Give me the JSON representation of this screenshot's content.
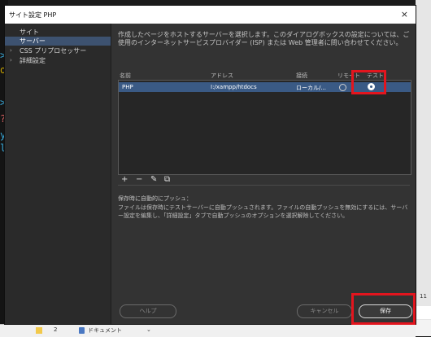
{
  "dialog": {
    "title": "サイト設定 PHP",
    "close_glyph": "×"
  },
  "sidebar": {
    "items": [
      {
        "label": "サイト",
        "chevron": ""
      },
      {
        "label": "サーバー",
        "chevron": ""
      },
      {
        "label": "CSS プリプロセッサー",
        "chevron": "›"
      },
      {
        "label": "詳細設定",
        "chevron": "›"
      }
    ],
    "selected_index": 1
  },
  "content": {
    "description": "作成したページをホストするサーバーを選択します。このダイアログボックスの設定については、ご使用のインターネットサービスプロバイダー (ISP) または Web 管理者に問い合わせてください。",
    "columns": [
      "名前",
      "アドレス",
      "接続",
      "リモート",
      "テスト"
    ],
    "rows": [
      {
        "name": "PHP",
        "address": "I:/xampp/htdocs",
        "connection": "ローカル/...",
        "remote": false,
        "testing": true
      }
    ],
    "tools": {
      "add": "+",
      "remove": "−",
      "edit": "✎",
      "duplicate": "⧉"
    },
    "auto_push_heading": "保存時に自動的にプッシュ：",
    "auto_push_text": "ファイルは保存時にテストサーバーに自動プッシュされます。ファイルの自動プッシュを無効にするには、サーバー設定を編集し、「詳細設定」タブで自動プッシュのオプションを選択解除してください。"
  },
  "buttons": {
    "help": "ヘルプ",
    "cancel": "キャンセル",
    "save": "保存"
  },
  "background": {
    "left_glyphs": [
      ">",
      "o",
      ">",
      "?",
      "y",
      "l"
    ],
    "right_number": "11",
    "taskbar_num": "2",
    "taskbar_doc": "ドキュメント",
    "taskbar_chevron": "⌄"
  },
  "colors": {
    "dialog_bg": "#333333",
    "selected_row": "#3a5a85",
    "selected_nav": "#3d5270",
    "highlight_red": "#e3151e"
  }
}
